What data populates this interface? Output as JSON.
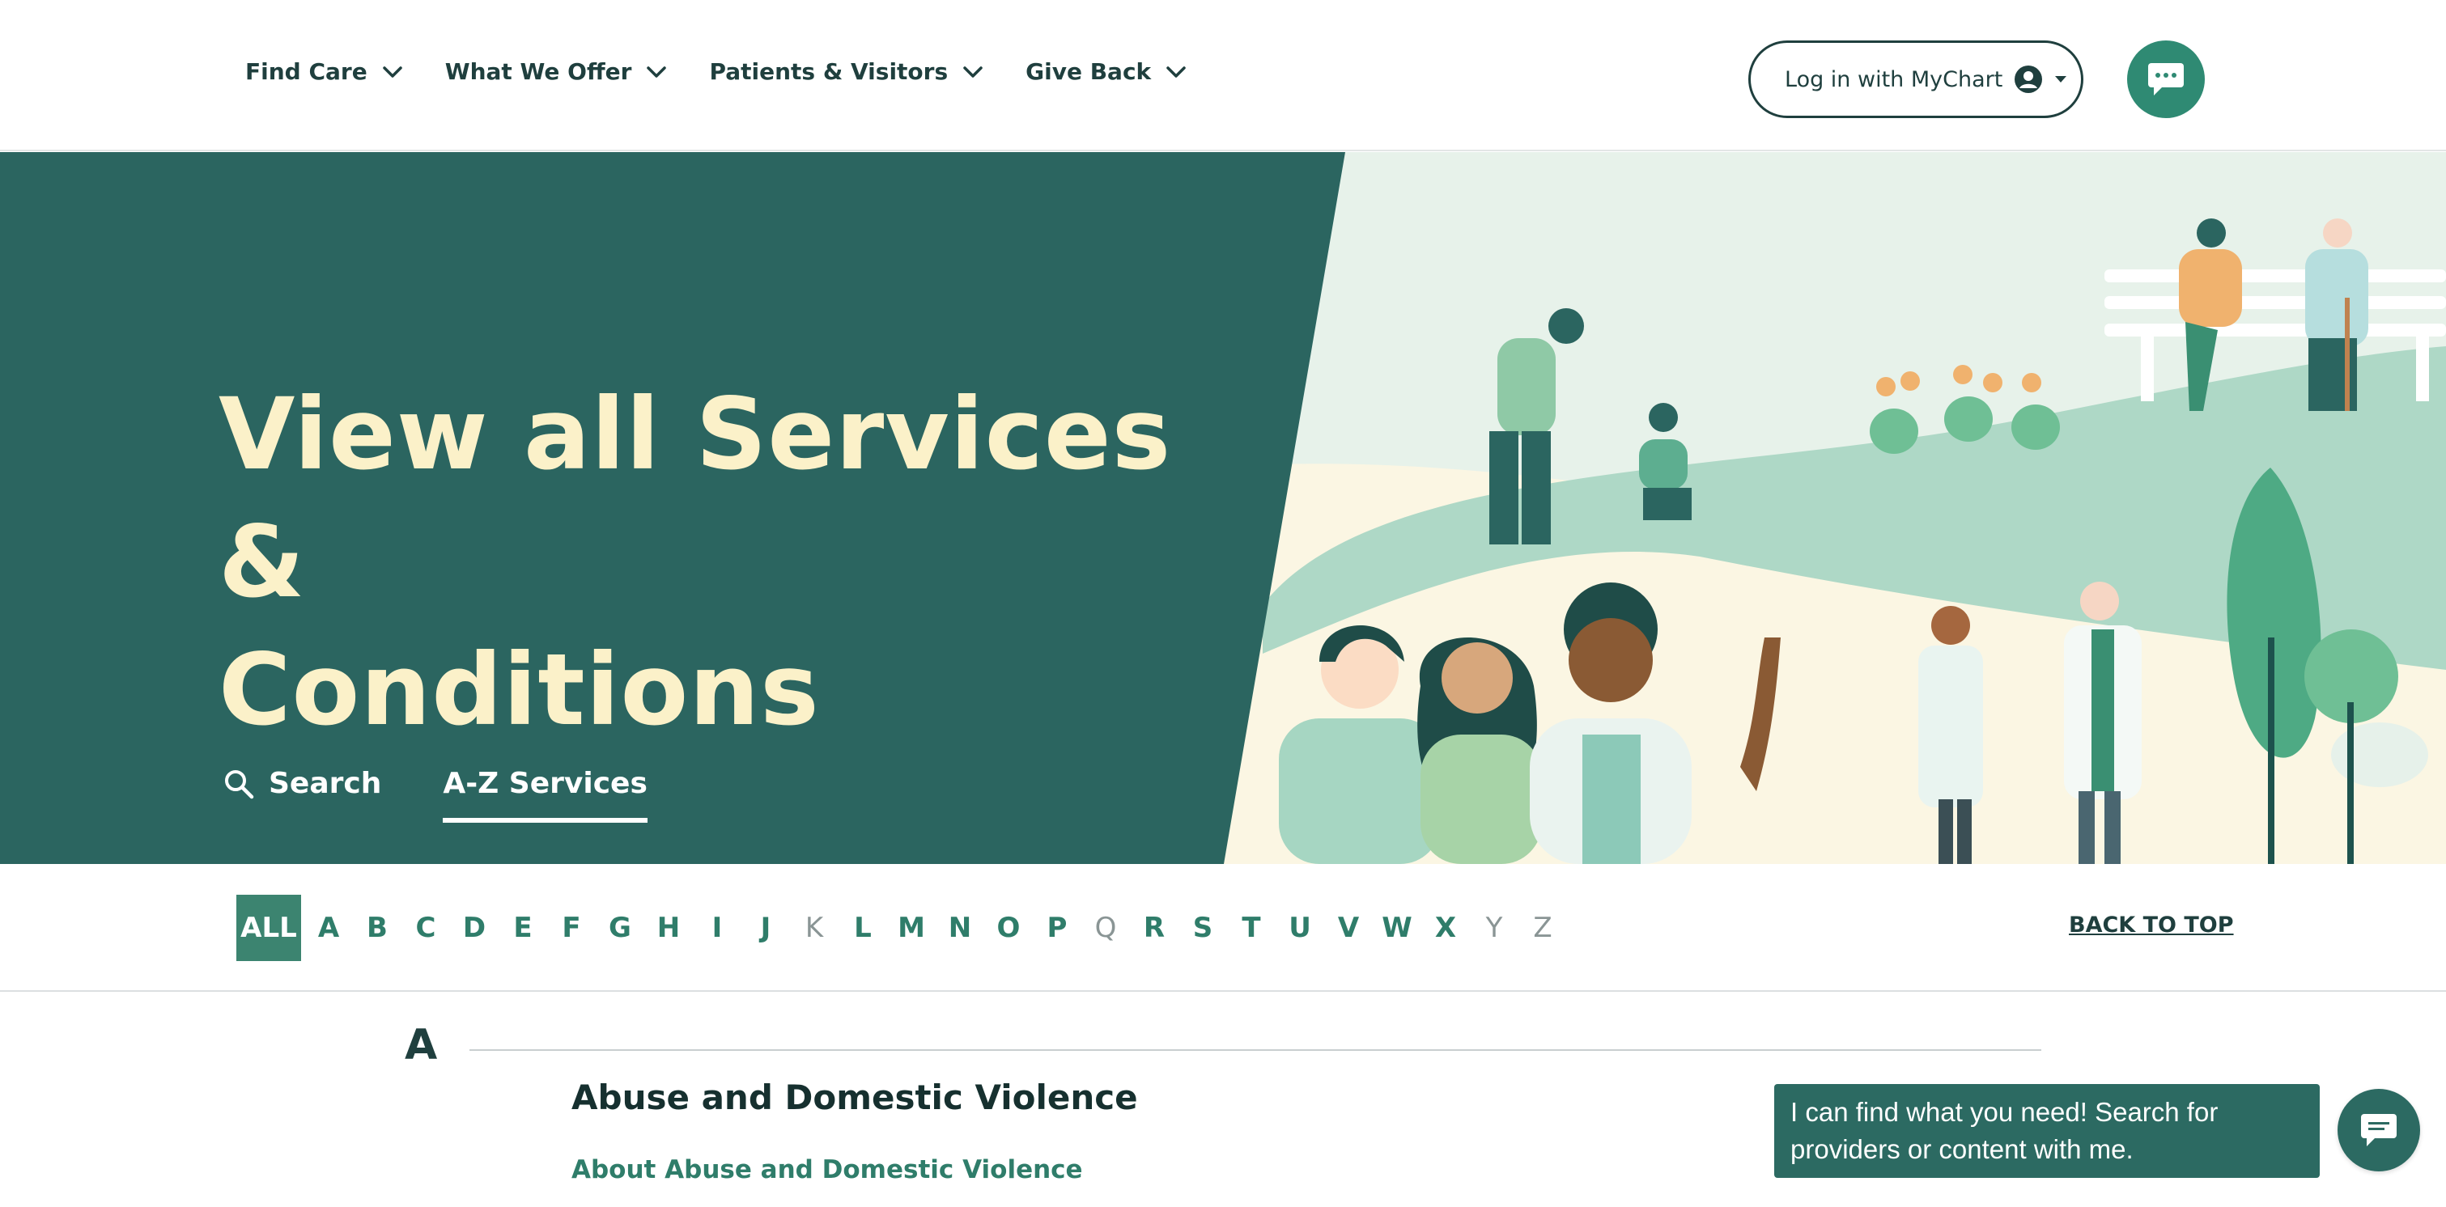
{
  "header": {
    "nav": [
      {
        "label": "Find Care"
      },
      {
        "label": "What We Offer"
      },
      {
        "label": "Patients & Visitors"
      },
      {
        "label": "Give Back"
      }
    ],
    "login_label": "Log in with MyChart"
  },
  "hero": {
    "title_line1": "View all Services &",
    "title_line2": "Conditions",
    "tabs": {
      "search": "Search",
      "az": "A-Z Services"
    }
  },
  "alphabet": {
    "all": "ALL",
    "letters": [
      {
        "letter": "A",
        "enabled": true
      },
      {
        "letter": "B",
        "enabled": true
      },
      {
        "letter": "C",
        "enabled": true
      },
      {
        "letter": "D",
        "enabled": true
      },
      {
        "letter": "E",
        "enabled": true
      },
      {
        "letter": "F",
        "enabled": true
      },
      {
        "letter": "G",
        "enabled": true
      },
      {
        "letter": "H",
        "enabled": true
      },
      {
        "letter": "I",
        "enabled": true
      },
      {
        "letter": "J",
        "enabled": true
      },
      {
        "letter": "K",
        "enabled": false
      },
      {
        "letter": "L",
        "enabled": true
      },
      {
        "letter": "M",
        "enabled": true
      },
      {
        "letter": "N",
        "enabled": true
      },
      {
        "letter": "O",
        "enabled": true
      },
      {
        "letter": "P",
        "enabled": true
      },
      {
        "letter": "Q",
        "enabled": false
      },
      {
        "letter": "R",
        "enabled": true
      },
      {
        "letter": "S",
        "enabled": true
      },
      {
        "letter": "T",
        "enabled": true
      },
      {
        "letter": "U",
        "enabled": true
      },
      {
        "letter": "V",
        "enabled": true
      },
      {
        "letter": "W",
        "enabled": true
      },
      {
        "letter": "X",
        "enabled": true
      },
      {
        "letter": "Y",
        "enabled": false
      },
      {
        "letter": "Z",
        "enabled": false
      }
    ],
    "back_to_top": "BACK TO TOP"
  },
  "listing": {
    "section_letter": "A",
    "service_title": "Abuse and Domestic Violence",
    "service_link": "About Abuse and Domestic Violence"
  },
  "chat": {
    "message": "I can find what you need! Search for providers or content with me."
  },
  "colors": {
    "brand_dark": "#2b6560",
    "accent": "#2f8a73",
    "hero_text": "#fbf1c9",
    "link": "#2f7d6a"
  },
  "icons": {
    "nav_chevron": "chevron-down-icon",
    "user": "user-circle-icon",
    "chat": "chat-icon",
    "search": "search-icon"
  }
}
